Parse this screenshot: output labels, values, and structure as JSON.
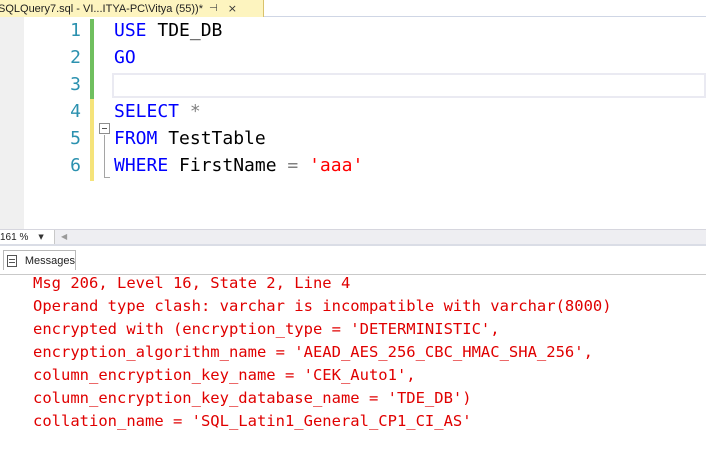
{
  "tab": {
    "title": "SQLQuery7.sql - VI...ITYA-PC\\Vitya (55))*",
    "pin_glyph": "⊣",
    "close_glyph": "×"
  },
  "editor": {
    "line_numbers": [
      "1",
      "2",
      "3",
      "4",
      "5",
      "6"
    ],
    "lines": [
      {
        "parts": [
          {
            "text": "USE",
            "kind": "kw"
          },
          {
            "text": " TDE_DB",
            "kind": "plain"
          }
        ]
      },
      {
        "parts": [
          {
            "text": "GO",
            "kind": "kw"
          }
        ]
      },
      {
        "parts": []
      },
      {
        "parts": [
          {
            "text": "SELECT",
            "kind": "kw"
          },
          {
            "text": " ",
            "kind": "plain"
          },
          {
            "text": "*",
            "kind": "op"
          }
        ]
      },
      {
        "parts": [
          {
            "text": "FROM",
            "kind": "kw"
          },
          {
            "text": " TestTable",
            "kind": "plain"
          }
        ]
      },
      {
        "parts": [
          {
            "text": "WHERE",
            "kind": "kw"
          },
          {
            "text": " FirstName ",
            "kind": "plain"
          },
          {
            "text": "=",
            "kind": "op"
          },
          {
            "text": " ",
            "kind": "plain"
          },
          {
            "text": "'aaa'",
            "kind": "str"
          }
        ]
      }
    ]
  },
  "zoom": {
    "value": "161 %",
    "dropdown_glyph": "▼",
    "scroll_left_glyph": "◀"
  },
  "results": {
    "tab_label": "Messages",
    "messages": [
      "Msg 206, Level 16, State 2, Line 4",
      "Operand type clash: varchar is incompatible with varchar(8000)",
      "encrypted with (encryption_type = 'DETERMINISTIC',",
      "encryption_algorithm_name = 'AEAD_AES_256_CBC_HMAC_SHA_256',",
      "column_encryption_key_name = 'CEK_Auto1',",
      "column_encryption_key_database_name = 'TDE_DB')",
      "collation_name = 'SQL_Latin1_General_CP1_CI_AS'"
    ]
  },
  "colors": {
    "keyword": "#0000ff",
    "operator": "#808080",
    "string": "#ff0000",
    "line_number": "#2b91af",
    "error_text": "#e00000",
    "tab_active_bg": "#fdf4bf"
  }
}
